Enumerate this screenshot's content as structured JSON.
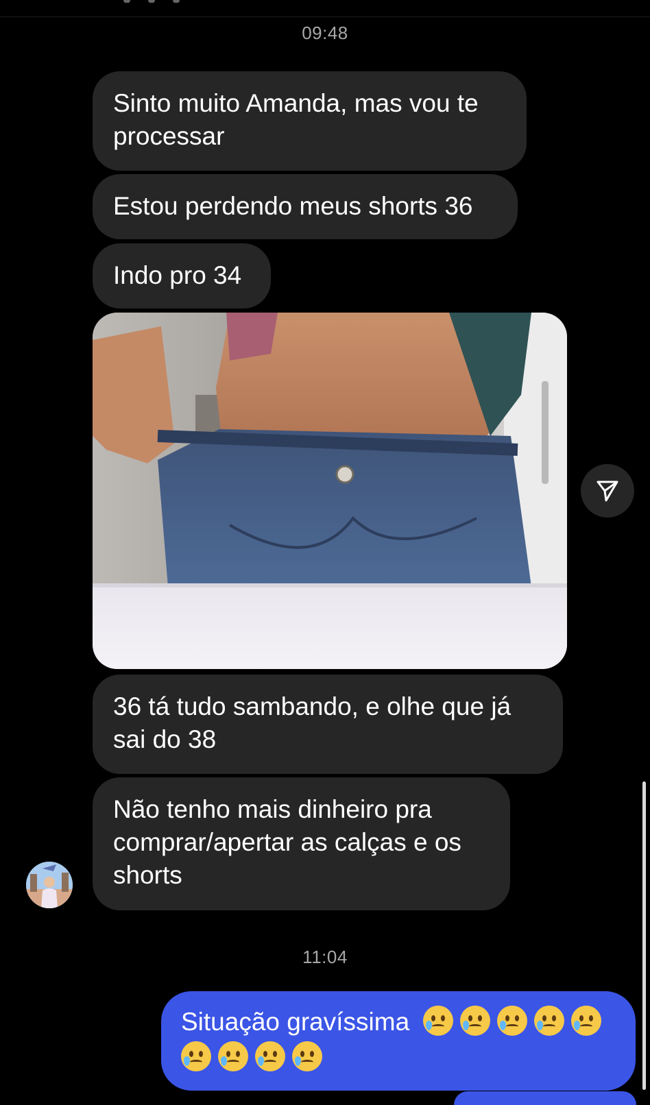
{
  "thread": {
    "timestamps": [
      "09:48",
      "11:04"
    ],
    "received_messages": [
      "Sinto muito Amanda, mas vou te\nprocessar",
      "Estou perdendo meus shorts 36",
      "Indo pro 34",
      "36 tá tudo sambando, e olhe que já\nsai do 38",
      "Não tenho mais dinheiro pra\ncomprar/apertar as calças e os\nshorts"
    ],
    "sent_message": {
      "text": "Situação gravíssima",
      "emoji": "crying-smiling-face",
      "emoji_count": 9
    }
  },
  "colors": {
    "background": "#000000",
    "received_bubble": "#262626",
    "sent_bubble": "#3b55e6",
    "timestamp_text": "#a8a8a8"
  },
  "icons": {
    "share": "paper-plane-icon"
  }
}
